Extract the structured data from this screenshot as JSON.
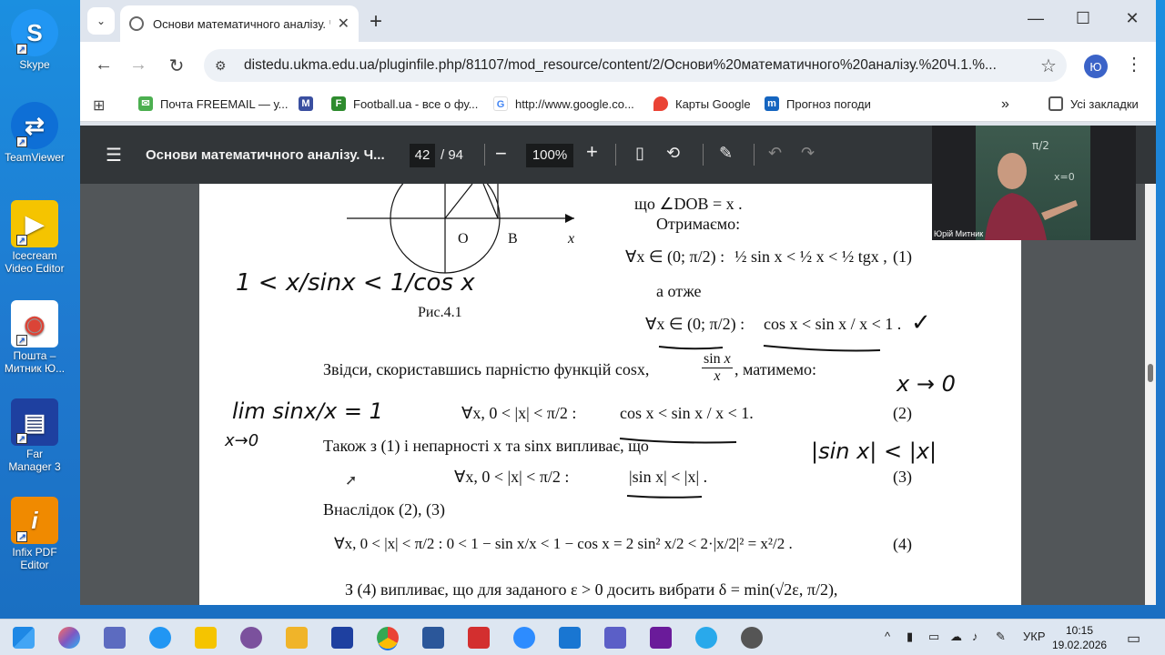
{
  "desktop": {
    "icons": [
      {
        "label": "Skype",
        "color": "#2196f3",
        "glyph": "S"
      },
      {
        "label": "TeamViewer",
        "color": "#0e6fd6",
        "glyph": "⇄"
      },
      {
        "label": "Icecream Video Editor",
        "color": "#f5c400",
        "glyph": "▶"
      },
      {
        "label": "Пошта – Митник Ю...",
        "color": "#ffffff",
        "glyph": "◉"
      },
      {
        "label": "Far Manager 3",
        "color": "#1e40a0",
        "glyph": "▤"
      },
      {
        "label": "Infix PDF Editor",
        "color": "#f08a00",
        "glyph": "i"
      }
    ]
  },
  "browser": {
    "tab_title": "Основи математичного аналізу. Ч",
    "url": "distedu.ukma.edu.ua/pluginfile.php/81107/mod_resource/content/2/Основи%20математичного%20аналізу.%20Ч.1.%...",
    "avatar_letter": "Ю",
    "bookmarks": [
      {
        "label": "Почта FREEMAIL — у...",
        "icon": "mail-icon",
        "color": "#4caf50"
      },
      {
        "label": "",
        "icon": "mv-logo-icon",
        "color": "#3a4fa0"
      },
      {
        "label": "Football.ua - все о фу...",
        "icon": "football-icon",
        "color": "#2e8b2e"
      },
      {
        "label": "http://www.google.co...",
        "icon": "google-icon",
        "color": "#4285f4"
      },
      {
        "label": "Карты Google",
        "icon": "maps-icon",
        "color": "#ea4335"
      },
      {
        "label": "Прогноз погоди",
        "icon": "weather-icon",
        "color": "#1565c0"
      }
    ],
    "all_bookmarks_label": "Усі закладки"
  },
  "pdf": {
    "title": "Основи математичного аналізу. Ч...",
    "page": "42",
    "page_total": "/ 94",
    "zoom": "100%"
  },
  "doc": {
    "line_what": "що  ∠DOB = x .",
    "obtain": "Отримаємо:",
    "and_so": "а отже",
    "fig_caption": "Рис.4.1",
    "label_O": "O",
    "label_B": "B",
    "label_x": "x",
    "eq1_num": "(1)",
    "eq2_num": "(2)",
    "eq3_num": "(3)",
    "eq4_num": "(4)",
    "para_parity": "Звідси, скориставшись парністю функцій  cosx,",
    "para_parity_end": ", матимемо:",
    "para_also": "Також з (1) і непарності x та sinx випливає, що",
    "para_conseq": "Внаслідок (2), (3)",
    "para_eps": "З (4) випливає, що для заданого  ε > 0  досить вибрати  δ = min(√2ε, π/2),",
    "eq1_lhs": "∀x ∈ (0; π/2)  :",
    "eq1_rhs": "½ sin x < ½ x < ½ tgx ,",
    "eq1b_lhs": "∀x ∈ (0; π/2)  :",
    "eq1b_rhs": "cos x < sin x / x < 1 .",
    "eq2_lhs": "∀x,   0 < |x| < π/2 :",
    "eq2_rhs": "cos x < sin x / x < 1.",
    "eq3_lhs": "∀x,   0 < |x| < π/2 :",
    "eq3_rhs": "|sin x| < |x| .",
    "eq4": "∀x,   0 < |x| < π/2  :    0 < 1 − sin x/x < 1 − cos x = 2 sin² x/2 < 2·|x/2|² = x²/2 ."
  },
  "handwriting": {
    "ineq_left": "1 < x/sinx < 1/cos x",
    "limit": "lim  sinx/x = 1",
    "limit_sub": "x→0",
    "x_to_0": "x → 0",
    "abs_sin": "|sin x| < |x|",
    "check": "✓"
  },
  "webcam": {
    "name": "Юрій Митник"
  },
  "taskbar": {
    "lang": "УКР",
    "time": "10:15",
    "date": "19.02.2026"
  }
}
